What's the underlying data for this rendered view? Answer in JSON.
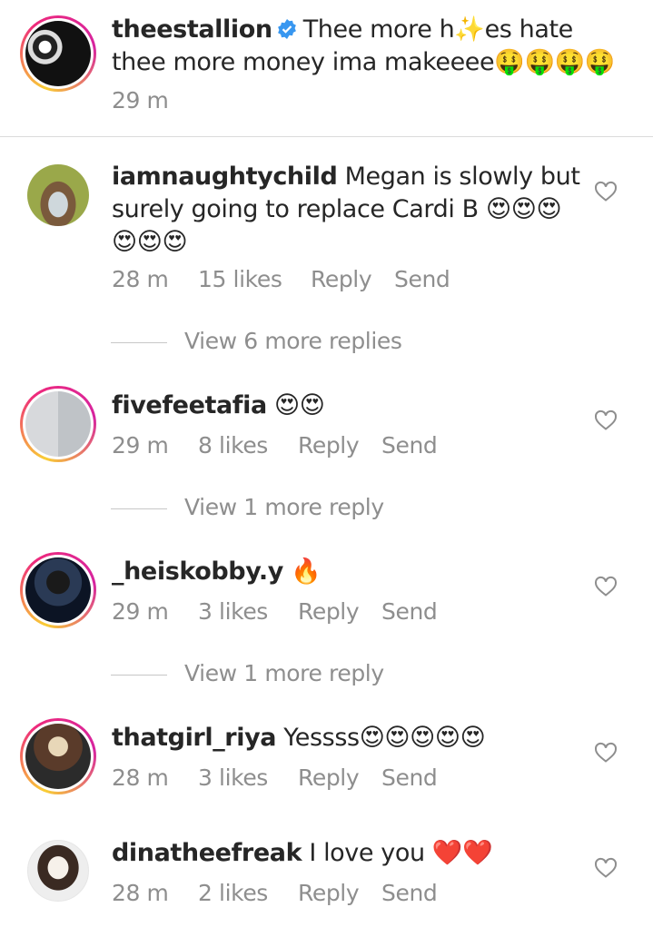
{
  "post": {
    "username": "theestallion",
    "caption_line1_pre": "Thee more h",
    "caption_sparkle": "✨",
    "caption_line1_post": "es hate",
    "caption_line2": "thee more money ima makeeee",
    "caption_emojis": "🤑🤑🤑🤑",
    "time": "29 m"
  },
  "comments": [
    {
      "username": "iamnaughtychild",
      "text1": "Megan is slowly but",
      "text2": "surely going to replace Cardi B",
      "emojis2": "😍😍😍",
      "text3": "😍😍😍",
      "time": "28 m",
      "likes": "15 likes",
      "reply": "Reply",
      "send": "Send",
      "view_replies": "View 6 more replies"
    },
    {
      "username": "fivefeetafia",
      "text1": "😍😍",
      "time": "29 m",
      "likes": "8 likes",
      "reply": "Reply",
      "send": "Send",
      "view_replies": "View 1 more reply"
    },
    {
      "username": "_heiskobby.y",
      "text1": "🔥",
      "time": "29 m",
      "likes": "3 likes",
      "reply": "Reply",
      "send": "Send",
      "view_replies": "View 1 more reply"
    },
    {
      "username": "thatgirl_riya",
      "text1": "Yessss",
      "emojis1": "😍😍😍😍😍",
      "time": "28 m",
      "likes": "3 likes",
      "reply": "Reply",
      "send": "Send"
    },
    {
      "username": "dinatheefreak",
      "text1": "I love you",
      "emojis1": "❤️❤️",
      "time": "28 m",
      "likes": "2 likes",
      "reply": "Reply",
      "send": "Send"
    }
  ],
  "icons": {
    "heart": "heart-outline-icon",
    "verified": "verified-badge-icon"
  },
  "colors": {
    "text": "#262626",
    "secondary": "#8e8e8e",
    "verified": "#3897f0",
    "divider": "#dbdbdb"
  }
}
